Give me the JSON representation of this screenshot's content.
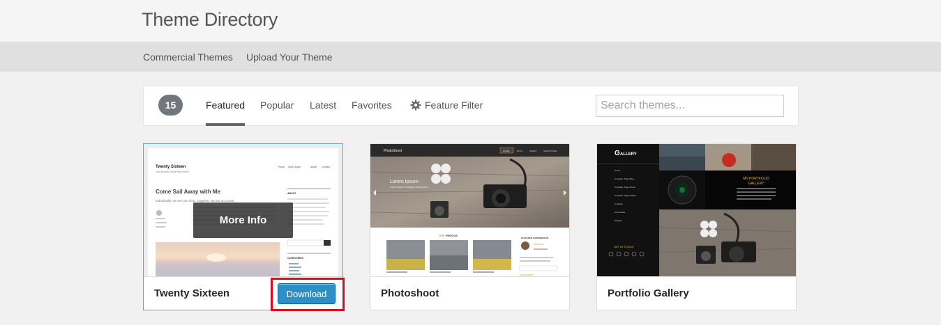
{
  "header": {
    "title": "Theme Directory"
  },
  "subnav": {
    "commercial": "Commercial Themes",
    "upload": "Upload Your Theme"
  },
  "filter": {
    "count": "15",
    "tabs": {
      "featured": "Featured",
      "popular": "Popular",
      "latest": "Latest",
      "favorites": "Favorites",
      "feature_filter": "Feature Filter"
    },
    "active_tab": "Featured",
    "search_placeholder": "Search themes..."
  },
  "themes": [
    {
      "name": "Twenty Sixteen",
      "more_info": "More Info",
      "download": "Download",
      "preview": {
        "site_title": "Twenty Sixteen",
        "site_tagline": "Just another WordPress theme",
        "nav": [
          "Home",
          "Style Guide",
          "About",
          "Contact"
        ],
        "post_title": "Come Sail Away with Me",
        "post_excerpt": "Individually, we are one drop. Together, we are an ocean.",
        "sidebar_about": "ABOUT",
        "sidebar_categories": "CATEGORIES"
      }
    },
    {
      "name": "Photoshoot",
      "preview": {
        "logo": "PhotoShoot",
        "nav": [
          "HOME",
          "BLOG",
          "PAGES",
          "SHORTCODE"
        ],
        "hero_title": "Lorem Ipsum",
        "hero_text": "Lorem ipsum is simply dummy text",
        "section_prefix": "TOP",
        "section_suffix": "PHOTOS",
        "contributor_title": "FEATURED CONTRIBUTOR",
        "contributor_name": "Nick Smith",
        "sidebar_categories": "CATEGORIES"
      }
    },
    {
      "name": "Portfolio Gallery",
      "preview": {
        "logo_initial": "G",
        "logo_rest": "ALLERY",
        "menu": [
          "Home",
          "Template: Page Blog",
          "Template: Page About",
          "Template: Page Gallery",
          "Contacts",
          "Shortcodes",
          "Widgets"
        ],
        "portfolio_title_line1": "MY PORTFOLIO",
        "portfolio_title_line2": "GALLERY",
        "get_in_touch": "GET IN TOUCH"
      }
    }
  ]
}
